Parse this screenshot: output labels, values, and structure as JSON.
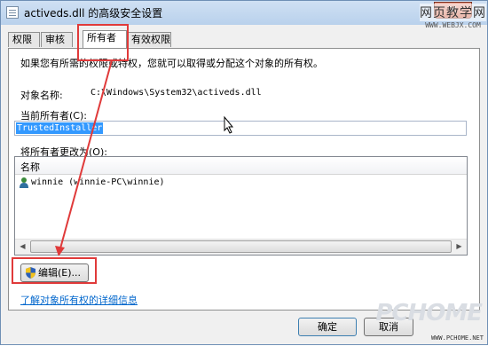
{
  "window": {
    "title": "activeds.dll 的高级安全设置",
    "close_label": "✕"
  },
  "watermark": {
    "site": "网页教学网",
    "url": "WWW.WEBJX.COM"
  },
  "tabs": [
    {
      "label": "权限"
    },
    {
      "label": "审核"
    },
    {
      "label": "所有者"
    },
    {
      "label": "有效权限"
    }
  ],
  "owner_page": {
    "description": "如果您有所需的权限或特权，您就可以取得或分配这个对象的所有权。",
    "object_name_label": "对象名称:",
    "object_name_value": "C:\\Windows\\System32\\activeds.dll",
    "current_owner_label": "当前所有者(C):",
    "current_owner_value": "TrustedInstaller",
    "change_owner_label": "将所有者更改为(O):",
    "list_header": "名称",
    "list_items": [
      {
        "label": "winnie (winnie-PC\\winnie)",
        "icon": "user-icon"
      }
    ],
    "edit_button": "编辑(E)...",
    "help_link": "了解对象所有权的详细信息"
  },
  "buttons": {
    "ok": "确定",
    "cancel": "取消"
  },
  "logo": {
    "brand": "PCHOME",
    "url": "WWW.PCHOME.NET"
  },
  "annotation_color": "#e03a3a"
}
